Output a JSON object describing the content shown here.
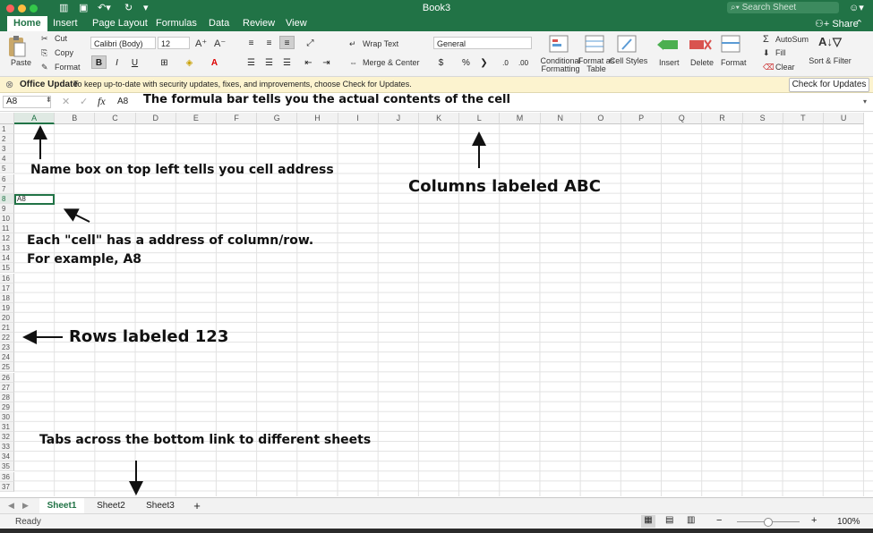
{
  "window": {
    "title": "Book3",
    "search_placeholder": "Search Sheet",
    "share_label": "Share"
  },
  "menu": {
    "tabs": [
      "Home",
      "Insert",
      "Page Layout",
      "Formulas",
      "Data",
      "Review",
      "View"
    ]
  },
  "ribbon": {
    "paste": "Paste",
    "cut": "Cut",
    "copy": "Copy",
    "format_painter": "Format",
    "font_name": "Calibri (Body)",
    "font_size": "12",
    "wrap_text": "Wrap Text",
    "merge_center": "Merge & Center",
    "number_format": "General",
    "conditional_formatting": "Conditional Formatting",
    "format_as_table": "Format as Table",
    "cell_styles": "Cell Styles",
    "insert": "Insert",
    "delete": "Delete",
    "format": "Format",
    "autosum": "AutoSum",
    "fill": "Fill",
    "clear": "Clear",
    "sort_filter": "Sort & Filter"
  },
  "infobar": {
    "title": "Office Update",
    "message": "To keep up-to-date with security updates, fixes, and improvements, choose Check for Updates.",
    "button": "Check for Updates"
  },
  "formula_bar": {
    "name_box": "A8",
    "fx": "fx",
    "content": "A8"
  },
  "grid": {
    "columns": [
      "A",
      "B",
      "C",
      "D",
      "E",
      "F",
      "G",
      "H",
      "I",
      "J",
      "K",
      "L",
      "M",
      "N",
      "O",
      "P",
      "Q",
      "R",
      "S",
      "T",
      "U"
    ],
    "rows": [
      "1",
      "2",
      "3",
      "4",
      "5",
      "6",
      "7",
      "8",
      "9",
      "10",
      "11",
      "12",
      "13",
      "14",
      "15",
      "16",
      "17",
      "18",
      "19",
      "20",
      "21",
      "22",
      "23",
      "24",
      "25",
      "26",
      "27",
      "28",
      "29",
      "30",
      "31",
      "32",
      "33",
      "34",
      "35",
      "36",
      "37"
    ],
    "selected_cell_value": "A8"
  },
  "annotations": {
    "formula_bar": "The formula bar tells you the actual contents of the cell",
    "name_box": "Name box on top left tells you cell address",
    "columns": "Columns labeled ABC",
    "cell_line1": "Each \"cell\" has a address of column/row.",
    "cell_line2": "For example, A8",
    "rows": "Rows labeled 123",
    "tabs": "Tabs across the bottom link to different sheets"
  },
  "sheets": {
    "tabs": [
      "Sheet1",
      "Sheet2",
      "Sheet3"
    ],
    "add": "+"
  },
  "status": {
    "ready": "Ready",
    "zoom": "100%"
  },
  "colors": {
    "excel_green": "#217346",
    "infobar_bg": "#fcf3cf"
  }
}
